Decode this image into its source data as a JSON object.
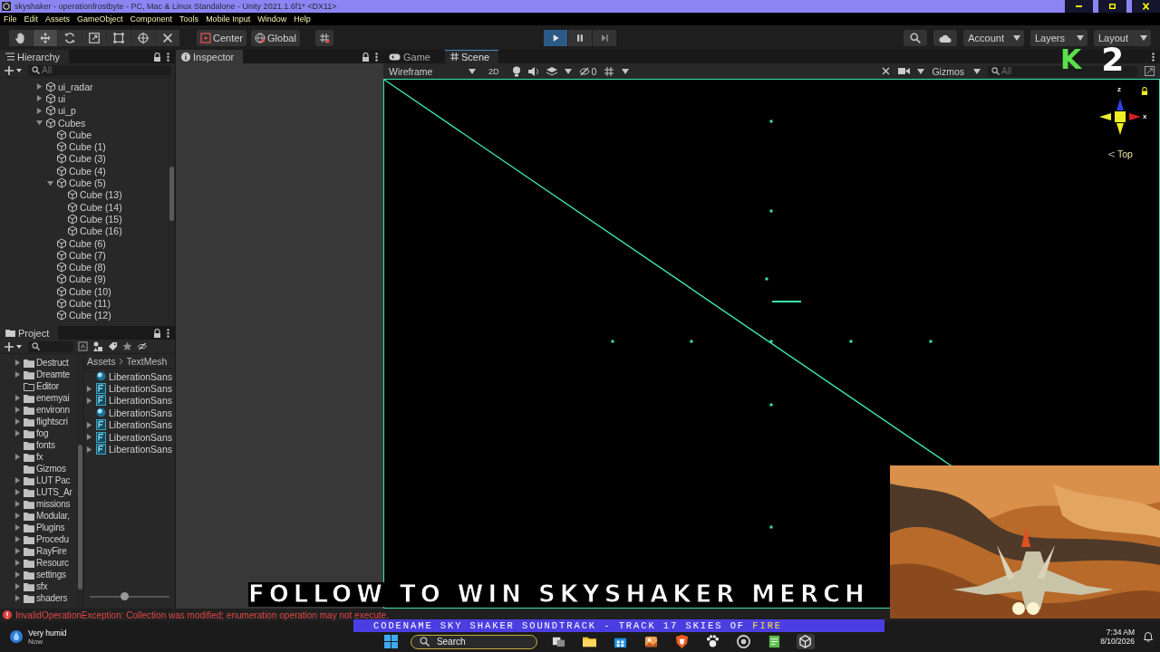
{
  "window": {
    "title": "skyshaker - operationfrostbyte - PC, Mac & Linux Standalone - Unity 2021.1.6f1* <DX11>"
  },
  "menu": [
    "File",
    "Edit",
    "Assets",
    "GameObject",
    "Component",
    "Tools",
    "Mobile Input",
    "Window",
    "Help"
  ],
  "toolbar": {
    "tools": [
      {
        "kind": "hand",
        "selected": false
      },
      {
        "kind": "move",
        "selected": true
      },
      {
        "kind": "rotate",
        "selected": false
      },
      {
        "kind": "scale",
        "selected": false
      },
      {
        "kind": "rect",
        "selected": false
      },
      {
        "kind": "transform",
        "selected": false
      },
      {
        "kind": "custom",
        "selected": false
      }
    ],
    "pivot": "Center",
    "space": "Global",
    "playback": [
      {
        "kind": "play",
        "selected": true
      },
      {
        "kind": "pause",
        "selected": false
      },
      {
        "kind": "step",
        "selected": false
      }
    ],
    "account": "Account",
    "layers": "Layers",
    "layout": "Layout"
  },
  "hierarchy": {
    "title": "Hierarchy",
    "search_placeholder": "All",
    "tree": [
      {
        "name": "ui_radar",
        "expanded": false
      },
      {
        "name": "ui",
        "expanded": false
      },
      {
        "name": "ui_p",
        "expanded": false
      },
      {
        "name": "Cubes",
        "expanded": true,
        "children": [
          {
            "name": "Cube"
          },
          {
            "name": "Cube (1)"
          },
          {
            "name": "Cube (3)"
          },
          {
            "name": "Cube (4)"
          },
          {
            "name": "Cube (5)",
            "expanded": true,
            "children": [
              {
                "name": "Cube (13)"
              },
              {
                "name": "Cube (14)"
              },
              {
                "name": "Cube (15)"
              },
              {
                "name": "Cube (16)"
              }
            ]
          },
          {
            "name": "Cube (6)"
          },
          {
            "name": "Cube (7)"
          },
          {
            "name": "Cube (8)"
          },
          {
            "name": "Cube (9)"
          },
          {
            "name": "Cube (10)"
          },
          {
            "name": "Cube (11)"
          },
          {
            "name": "Cube (12)"
          }
        ]
      }
    ]
  },
  "project": {
    "title": "Project",
    "folders": [
      {
        "name": "Destruct",
        "expandable": true,
        "empty": false
      },
      {
        "name": "Dreamte",
        "expandable": true,
        "empty": false
      },
      {
        "name": "Editor",
        "expandable": false,
        "empty": true
      },
      {
        "name": "enemyai",
        "expandable": true,
        "empty": false
      },
      {
        "name": "environn",
        "expandable": true,
        "empty": false
      },
      {
        "name": "flightscri",
        "expandable": true,
        "empty": false
      },
      {
        "name": "fog",
        "expandable": true,
        "empty": false
      },
      {
        "name": "fonts",
        "expandable": false,
        "empty": false
      },
      {
        "name": "fx",
        "expandable": true,
        "empty": false
      },
      {
        "name": "Gizmos",
        "expandable": false,
        "empty": false
      },
      {
        "name": "LUT Pac",
        "expandable": true,
        "empty": false
      },
      {
        "name": "LUTS_Ar",
        "expandable": true,
        "empty": false
      },
      {
        "name": "missions",
        "expandable": true,
        "empty": false
      },
      {
        "name": "Modular,",
        "expandable": true,
        "empty": false
      },
      {
        "name": "Plugins",
        "expandable": true,
        "empty": false
      },
      {
        "name": "Procedu",
        "expandable": true,
        "empty": false
      },
      {
        "name": "RayFire",
        "expandable": true,
        "empty": false
      },
      {
        "name": "Resourc",
        "expandable": true,
        "empty": false
      },
      {
        "name": "settings",
        "expandable": true,
        "empty": false
      },
      {
        "name": "sfx",
        "expandable": true,
        "empty": false
      },
      {
        "name": "shaders",
        "expandable": true,
        "empty": false
      }
    ],
    "breadcrumb": [
      "Assets",
      "TextMesh"
    ],
    "icon_size": {
      "level": 0.42
    },
    "assets": [
      {
        "name": "LiberationSans",
        "kind": "material"
      },
      {
        "name": "LiberationSans",
        "kind": "font"
      },
      {
        "name": "LiberationSans",
        "kind": "font"
      },
      {
        "name": "LiberationSans",
        "kind": "material"
      },
      {
        "name": "LiberationSans",
        "kind": "font"
      },
      {
        "name": "LiberationSans",
        "kind": "font"
      },
      {
        "name": "LiberationSans",
        "kind": "font"
      }
    ]
  },
  "inspector": {
    "title": "Inspector"
  },
  "scene": {
    "tabs": [
      {
        "label": "Game",
        "kind": "game",
        "selected": false
      },
      {
        "label": "Scene",
        "kind": "scene",
        "selected": true
      }
    ],
    "draw_mode": "Wireframe",
    "mode_2d": "2D",
    "hidden_count": "0",
    "gizmos": "Gizmos",
    "search_placeholder": "All",
    "axes": [
      "z",
      "x"
    ],
    "orientation": "Top"
  },
  "console": {
    "message": "InvalidOperationException: Collection was modified; enumeration operation may not execute."
  },
  "stream_overlay": {
    "channel_mark": "K",
    "number": "2",
    "headline": "FOLLOW TO WIN SKYSHAKER MERCH",
    "now_playing": "CODENAME SKY SHAKER SOUNDTRACK - TRACK 17 SKIES OF",
    "now_playing_highlight": "FIRE"
  },
  "taskbar": {
    "weather": "Very humid",
    "weather_time": "Now",
    "search_placeholder": "Search",
    "apps": [
      {
        "kind": "taskview",
        "selected": false
      },
      {
        "kind": "folder",
        "selected": false
      },
      {
        "kind": "store",
        "selected": false
      },
      {
        "kind": "photos",
        "selected": false
      },
      {
        "kind": "shield",
        "selected": false
      },
      {
        "kind": "paw",
        "selected": false
      },
      {
        "kind": "browser",
        "selected": false
      },
      {
        "kind": "notepad",
        "selected": false
      },
      {
        "kind": "unity",
        "selected": true
      }
    ],
    "time": "7:34 AM",
    "date": "8/10/2026"
  }
}
